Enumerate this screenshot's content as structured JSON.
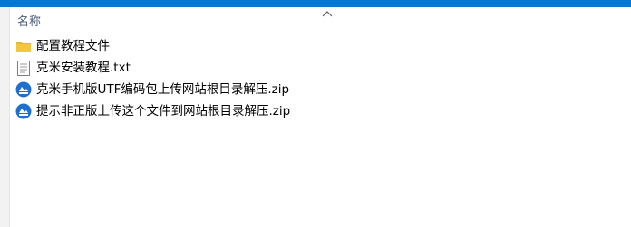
{
  "header": {
    "name_column_label": "名称"
  },
  "files": [
    {
      "name": "配置教程文件",
      "icon": "folder-icon"
    },
    {
      "name": "克米安装教程.txt",
      "icon": "text-file-icon"
    },
    {
      "name": "克米手机版UTF编码包上传网站根目录解压.zip",
      "icon": "zip-archive-icon"
    },
    {
      "name": "提示非正版上传这个文件到网站根目录解压.zip",
      "icon": "zip-archive-icon"
    }
  ],
  "colors": {
    "accent": "#0078d7",
    "header_text": "#4c607a",
    "folder": "#f5c542"
  }
}
